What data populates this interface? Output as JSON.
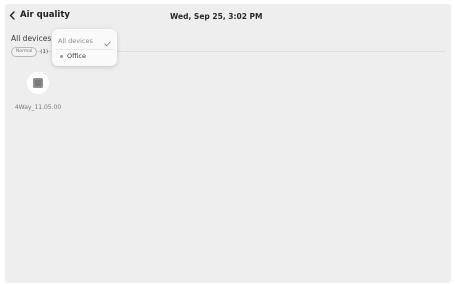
{
  "header": {
    "title": "Air quality",
    "back_icon": "chevron-left-icon",
    "datetime": "Wed, Sep 25, 3:02 PM"
  },
  "filter": {
    "label": "All devices",
    "status_badge": "Normal",
    "status_count": "(1)"
  },
  "dropdown": {
    "selected": "All devices",
    "selected_icon": "checkmark-icon",
    "options": [
      "Office"
    ]
  },
  "devices": [
    {
      "name": "4Way_11.05.00",
      "icon": "air-purifier-icon"
    }
  ]
}
